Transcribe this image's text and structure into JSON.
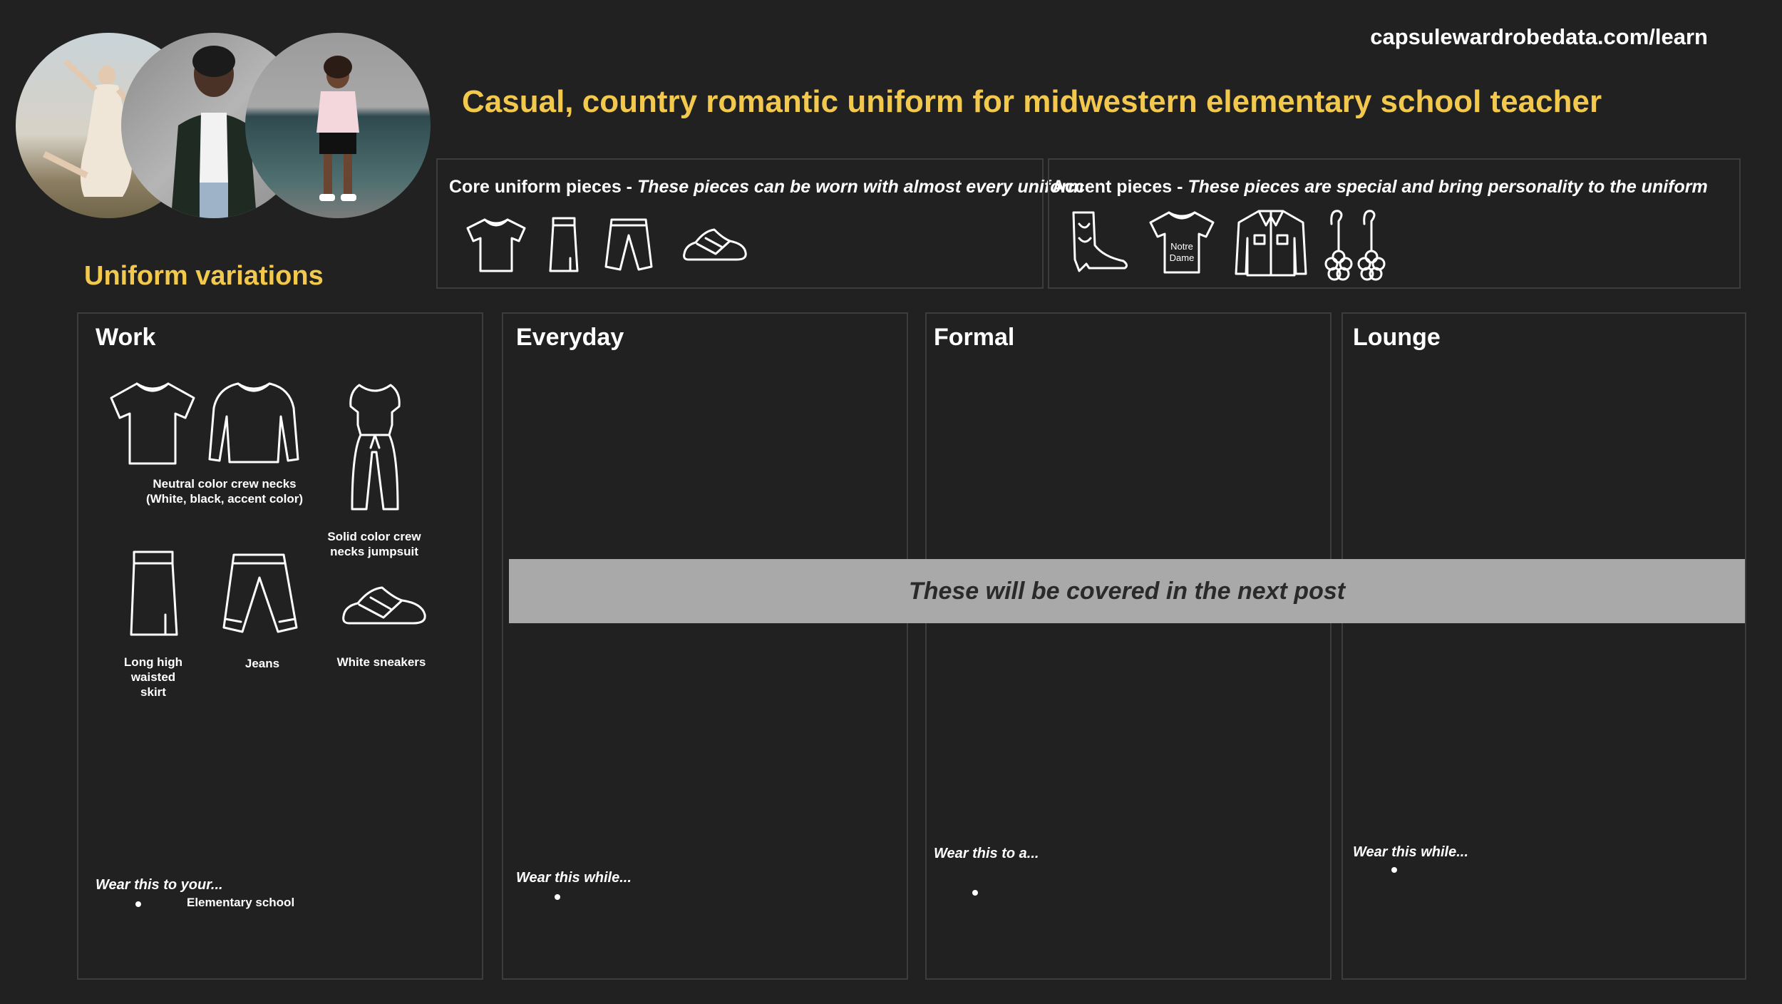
{
  "header": {
    "url": "capsulewardrobedata.com/learn",
    "title": "Casual, country romantic uniform for midwestern elementary school teacher"
  },
  "section_title": "Uniform variations",
  "core": {
    "label": "Core uniform pieces - ",
    "desc": "These pieces can be worn with almost every uniform",
    "icons": [
      "tshirt-icon",
      "skirt-icon",
      "jeans-icon",
      "sneaker-icon"
    ]
  },
  "accent": {
    "label": "Accent pieces - ",
    "desc": "These pieces are special and bring personality to the uniform",
    "icons": [
      "cowboy-boot-icon",
      "graphic-tee-icon",
      "denim-jacket-icon",
      "flower-earrings-icon"
    ],
    "tee_text_line1": "Notre",
    "tee_text_line2": "Dame"
  },
  "columns": {
    "work": {
      "title": "Work",
      "crew_caption_1": "Neutral color crew necks",
      "crew_caption_2": "(White, black, accent color)",
      "jumpsuit_caption_1": "Solid color crew",
      "jumpsuit_caption_2": "necks jumpsuit",
      "skirt_caption_1": "Long high",
      "skirt_caption_2": "waisted",
      "skirt_caption_3": "skirt",
      "jeans_caption": "Jeans",
      "sneakers_caption": "White sneakers",
      "wear_label": "Wear this to your...",
      "wear_item": "Elementary school"
    },
    "everyday": {
      "title": "Everyday",
      "wear_label": "Wear this while..."
    },
    "formal": {
      "title": "Formal",
      "wear_label": "Wear this to a..."
    },
    "lounge": {
      "title": "Lounge",
      "wear_label": "Wear this while..."
    }
  },
  "banner": "These will be covered in the next post",
  "colors": {
    "background": "#212121",
    "accent_yellow": "#f2c94c",
    "banner": "#a9a9a9"
  }
}
